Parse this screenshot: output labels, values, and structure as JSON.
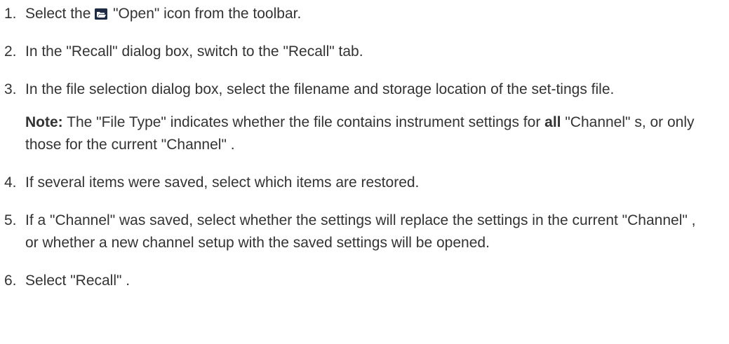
{
  "steps": [
    {
      "num": "1.",
      "pre": "Select the ",
      "icon": "open-folder-icon",
      "post": " \"Open\" icon from the toolbar."
    },
    {
      "num": "2.",
      "text": "In the \"Recall\" dialog box, switch to the \"Recall\" tab."
    },
    {
      "num": "3.",
      "text": "In the file selection dialog box, select the filename and storage location of the set-tings file.",
      "note": {
        "label": "Note:",
        "text_a": " The \"File Type\" indicates whether the file contains instrument settings for ",
        "emph": "all",
        "text_b": " \"Channel\" s, or only those for the current \"Channel\" ."
      }
    },
    {
      "num": "4.",
      "text": "If several items were saved, select which items are restored."
    },
    {
      "num": "5.",
      "text": "If a \"Channel\" was saved, select whether the settings will replace the settings in the current \"Channel\" , or whether a new channel setup with the saved settings will be opened."
    },
    {
      "num": "6.",
      "text": "Select \"Recall\" ."
    }
  ],
  "colors": {
    "text": "#333333",
    "icon_bg": "#1f2a44"
  }
}
